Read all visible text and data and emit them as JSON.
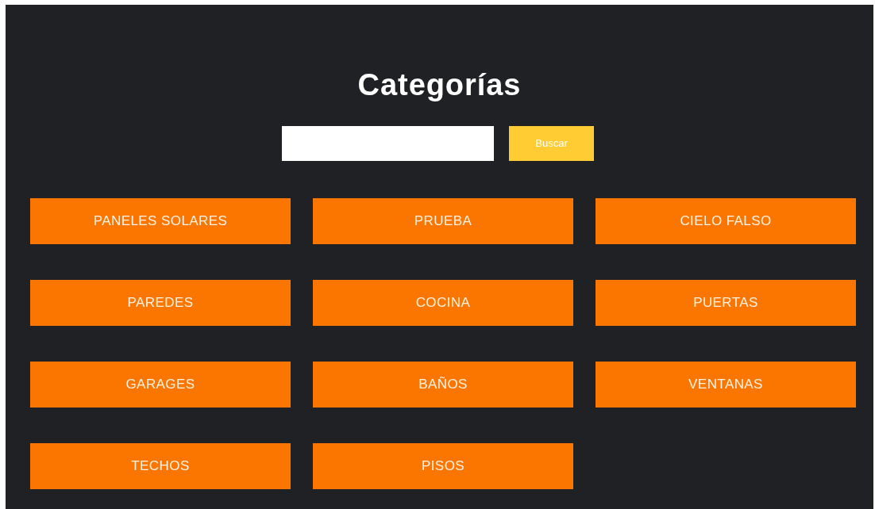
{
  "title": "Categorías",
  "search": {
    "button": "Buscar"
  },
  "categories": [
    {
      "label": "PANELES SOLARES"
    },
    {
      "label": "PRUEBA"
    },
    {
      "label": "CIELO FALSO"
    },
    {
      "label": "PAREDES"
    },
    {
      "label": "COCINA"
    },
    {
      "label": "PUERTAS"
    },
    {
      "label": "GARAGES"
    },
    {
      "label": "BAÑOS"
    },
    {
      "label": "VENTANAS"
    },
    {
      "label": "TECHOS"
    },
    {
      "label": "PISOS"
    }
  ]
}
